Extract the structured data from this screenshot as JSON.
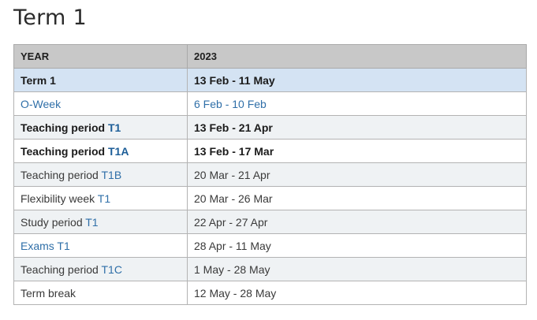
{
  "page": {
    "title": "Term 1"
  },
  "table": {
    "headers": {
      "col1": "YEAR",
      "col2": "2023"
    },
    "rows": [
      {
        "label": "Term 1",
        "label_link": "",
        "dates": "13 Feb - 11 May"
      },
      {
        "label": "",
        "label_link": "O-Week",
        "dates": "6 Feb - 10 Feb"
      },
      {
        "label": "Teaching period ",
        "label_link": "T1",
        "dates": "13 Feb - 21 Apr"
      },
      {
        "label": "Teaching period ",
        "label_link": "T1A",
        "dates": "13 Feb - 17 Mar"
      },
      {
        "label": "Teaching period ",
        "label_link": "T1B",
        "dates": "20 Mar - 21 Apr"
      },
      {
        "label": "Flexibility week ",
        "label_link": "T1",
        "dates": "20 Mar - 26 Mar"
      },
      {
        "label": "Study period ",
        "label_link": "T1",
        "dates": "22 Apr - 27 Apr"
      },
      {
        "label": "",
        "label_link": "Exams T1",
        "dates": "28 Apr - 11 May"
      },
      {
        "label": "Teaching period ",
        "label_link": "T1C",
        "dates": "1 May - 28 May"
      },
      {
        "label": "Term break",
        "label_link": "",
        "dates": "12 May - 28 May"
      }
    ]
  },
  "colors": {
    "header_bg": "#c8c8c8",
    "highlight_row_bg": "#d4e3f3",
    "shaded_row_bg": "#eff2f4",
    "link_color": "#2f6fa8",
    "border": "#b3b3b3"
  }
}
